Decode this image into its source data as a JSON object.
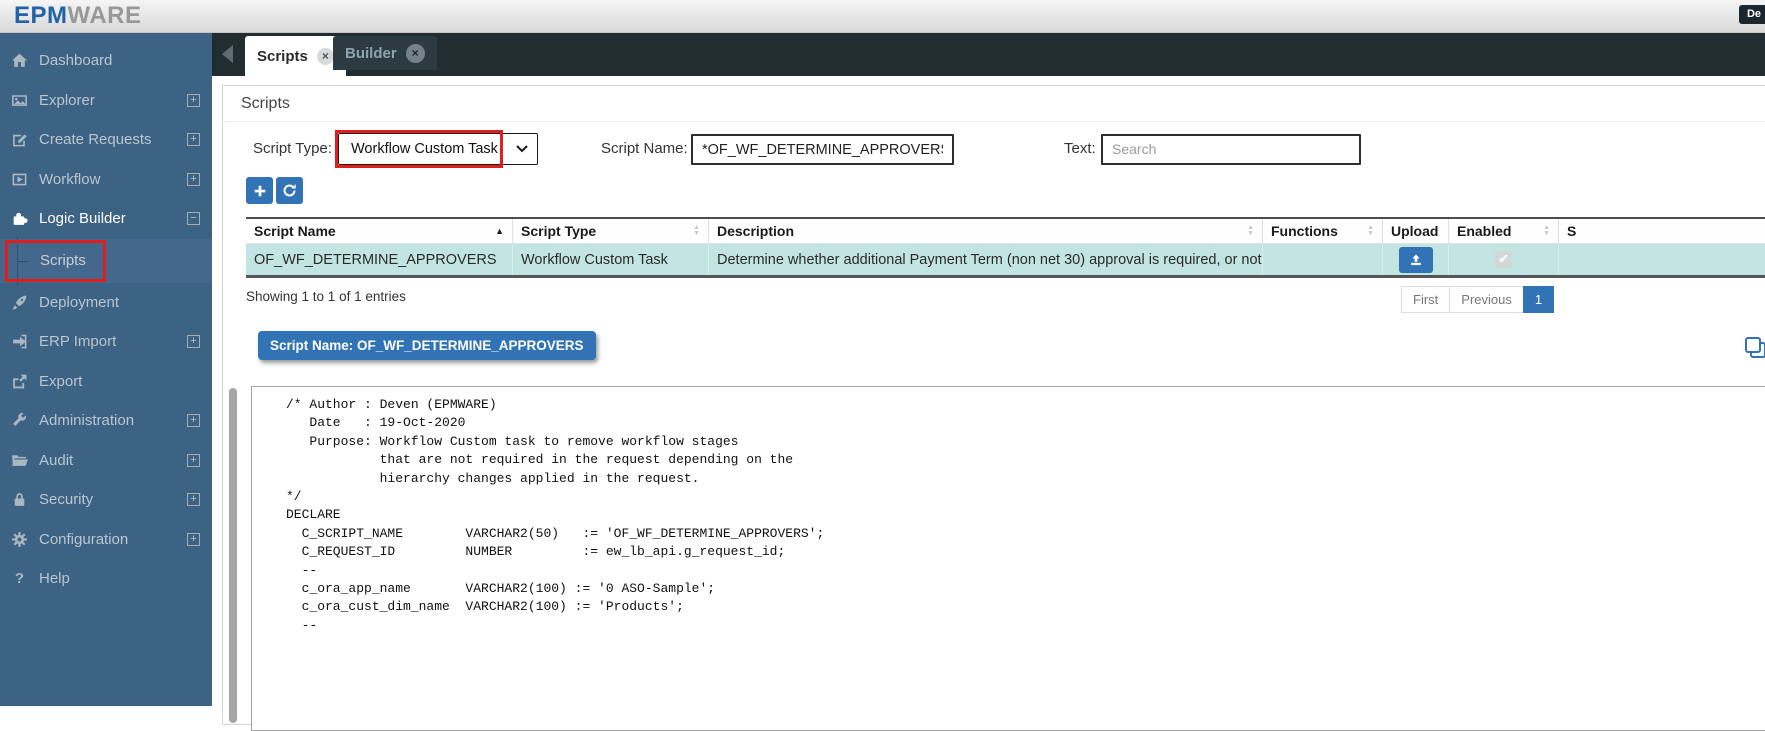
{
  "topbar": {
    "logo_epm": "EPM",
    "logo_ware": "WARE",
    "corner_badge": "De"
  },
  "glyphs": {
    "close": "×",
    "sort_asc": "▲",
    "sort_up": "▲",
    "sort_down": "▼",
    "check": "✔",
    "question": "?"
  },
  "sidebar": {
    "items": [
      {
        "label": "Dashboard"
      },
      {
        "label": "Explorer",
        "expander": "+"
      },
      {
        "label": "Create Requests",
        "expander": "+"
      },
      {
        "label": "Workflow",
        "expander": "+"
      },
      {
        "label": "Logic Builder",
        "expander": "−"
      },
      {
        "label": "Scripts"
      },
      {
        "label": "Deployment"
      },
      {
        "label": "ERP Import",
        "expander": "+"
      },
      {
        "label": "Export"
      },
      {
        "label": "Administration",
        "expander": "+"
      },
      {
        "label": "Audit",
        "expander": "+"
      },
      {
        "label": "Security",
        "expander": "+"
      },
      {
        "label": "Configuration",
        "expander": "+"
      },
      {
        "label": "Help"
      }
    ]
  },
  "tabs": [
    {
      "label": "Scripts",
      "active": true
    },
    {
      "label": "Builder",
      "active": false
    }
  ],
  "panel": {
    "title": "Scripts"
  },
  "filters": {
    "script_type_label": "Script Type:",
    "script_type_value": "Workflow Custom Task",
    "script_name_label": "Script Name:",
    "script_name_value": "*OF_WF_DETERMINE_APPROVERS*",
    "text_label": "Text:",
    "text_placeholder": "Search"
  },
  "table": {
    "columns": [
      "Script Name",
      "Script Type",
      "Description",
      "Functions",
      "Upload",
      "Enabled",
      "S"
    ],
    "rows": [
      {
        "script_name": "OF_WF_DETERMINE_APPROVERS",
        "script_type": "Workflow Custom Task",
        "description": "Determine whether additional Payment Term (non net 30) approval is required, or not.",
        "functions": "",
        "enabled": true
      }
    ]
  },
  "table_footer": {
    "showing_text": "Showing 1 to 1 of 1 entries",
    "pagination": [
      "First",
      "Previous",
      "1"
    ],
    "active_page": "1"
  },
  "script_viewer": {
    "badge": "Script Name: OF_WF_DETERMINE_APPROVERS",
    "code": "/* Author : Deven (EPMWARE)\n   Date   : 19-Oct-2020\n   Purpose: Workflow Custom task to remove workflow stages\n            that are not required in the request depending on the\n            hierarchy changes applied in the request.\n*/\nDECLARE\n  C_SCRIPT_NAME        VARCHAR2(50)   := 'OF_WF_DETERMINE_APPROVERS';\n  C_REQUEST_ID         NUMBER         := ew_lb_api.g_request_id;\n  --\n  c_ora_app_name       VARCHAR2(100) := '0 ASO-Sample';\n  c_ora_cust_dim_name  VARCHAR2(100) := 'Products';\n  --"
  },
  "colors": {
    "accent_blue": "#3173b4",
    "sidebar_blue": "#3d6384",
    "annotation_red": "#dd1f1f",
    "selected_row_teal": "#c2e4e3",
    "tabbar_dark": "#222d32"
  }
}
